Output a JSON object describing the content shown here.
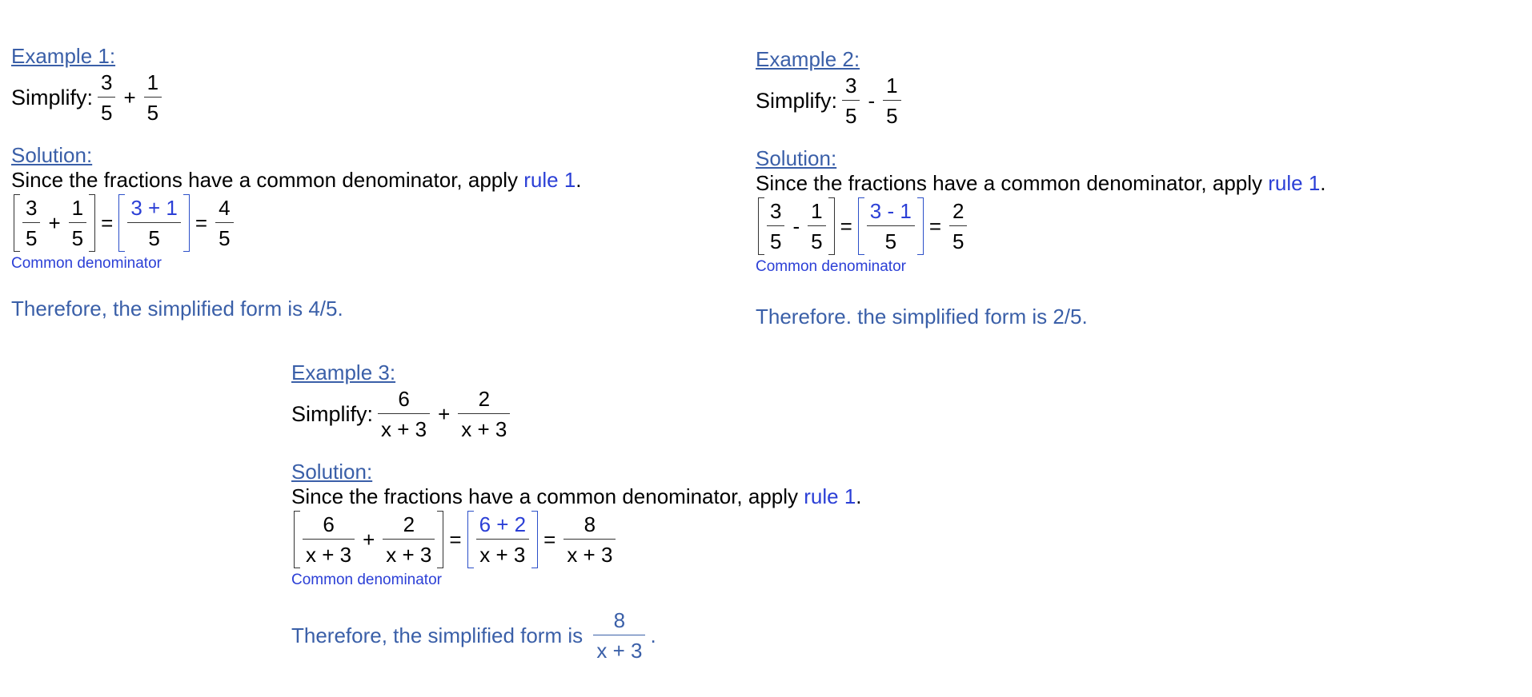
{
  "examples": [
    {
      "heading": "Example 1:",
      "simplify_label": "Simplify:",
      "problem": {
        "a_num": "3",
        "a_den": "5",
        "op": "+",
        "b_num": "1",
        "b_den": "5"
      },
      "solution_heading": "Solution:",
      "explanation_prefix": "Since the fractions have a common denominator, apply ",
      "rule_link": "rule 1",
      "explanation_suffix": ".",
      "work": {
        "a_num": "3",
        "a_den": "5",
        "op": "+",
        "b_num": "1",
        "b_den": "5",
        "eq1": "=",
        "c_num": "3 + 1",
        "c_den": "5",
        "eq2": "=",
        "r_num": "4",
        "r_den": "5"
      },
      "annotation": "Common denominator",
      "conclusion": "Therefore, the simplified form is 4/5."
    },
    {
      "heading": "Example 2:",
      "simplify_label": "Simplify:",
      "problem": {
        "a_num": "3",
        "a_den": "5",
        "op": "-",
        "b_num": "1",
        "b_den": "5"
      },
      "solution_heading": "Solution:",
      "explanation_prefix": "Since the fractions have a common denominator, apply ",
      "rule_link": "rule 1",
      "explanation_suffix": ".",
      "work": {
        "a_num": "3",
        "a_den": "5",
        "op": "-",
        "b_num": "1",
        "b_den": "5",
        "eq1": "=",
        "c_num": "3 - 1",
        "c_den": "5",
        "eq2": "=",
        "r_num": "2",
        "r_den": "5"
      },
      "annotation": "Common denominator",
      "conclusion": "Therefore. the simplified form is 2/5."
    },
    {
      "heading": "Example 3:",
      "simplify_label": "Simplify:",
      "problem": {
        "a_num": "6",
        "a_den": "x + 3",
        "op": "+",
        "b_num": "2",
        "b_den": "x + 3"
      },
      "solution_heading": "Solution:",
      "explanation_prefix": "Since the fractions have a common denominator, apply ",
      "rule_link": "rule 1",
      "explanation_suffix": ".",
      "work": {
        "a_num": "6",
        "a_den": "x + 3",
        "op": "+",
        "b_num": "2",
        "b_den": "x + 3",
        "eq1": "=",
        "c_num": "6 + 2",
        "c_den": "x + 3",
        "eq2": "=",
        "r_num": "8",
        "r_den": "x + 3"
      },
      "annotation": "Common denominator",
      "conclusion_prefix": "Therefore, the simplified form is ",
      "conclusion_num": "8",
      "conclusion_den": "x + 3",
      "conclusion_suffix": "."
    }
  ],
  "colors": {
    "heading": "#3a5fa8",
    "accent_blue": "#2b3fd6",
    "text": "#000000"
  }
}
